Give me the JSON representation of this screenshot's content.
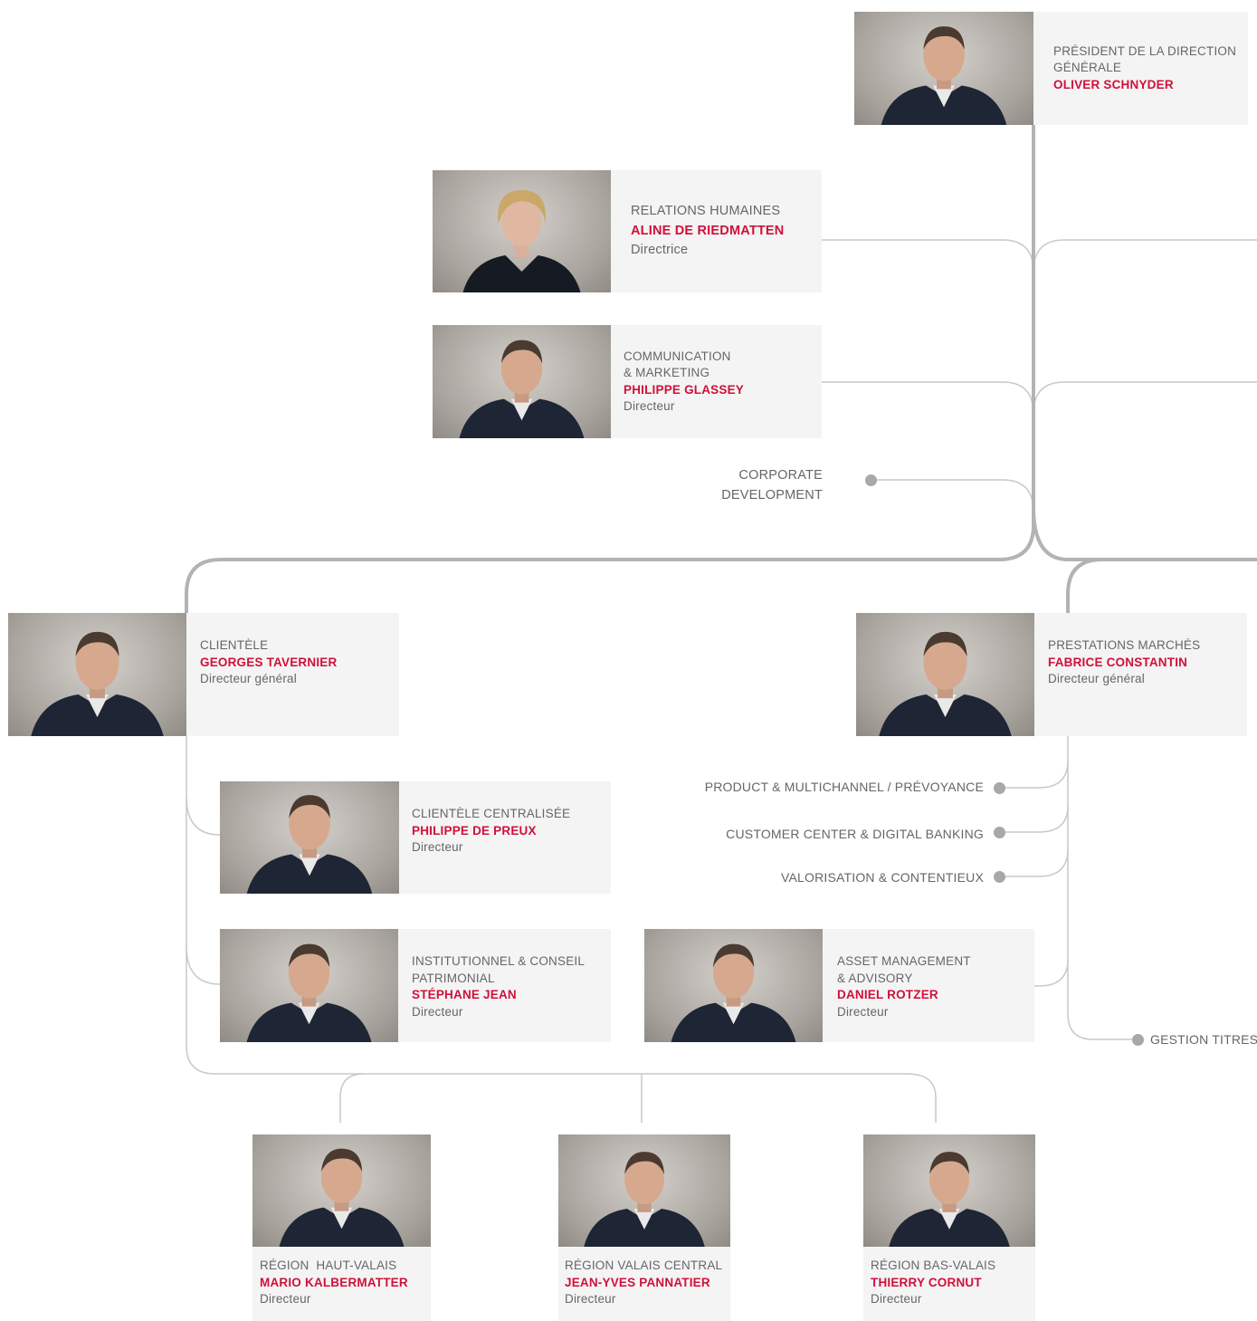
{
  "colors": {
    "accent": "#d0103a",
    "line": "#c8c8c8",
    "trunk": "#b5b5b5",
    "card": "#f4f4f4",
    "text": "#666666"
  },
  "president": {
    "role": "PRÉSIDENT DE LA DIRECTION GÉNÉRALE",
    "name": "OLIVER SCHNYDER"
  },
  "hr": {
    "role": "RELATIONS HUMAINES",
    "name": "ALINE DE RIEDMATTEN",
    "title": "Directrice"
  },
  "comm": {
    "role_line1": "COMMUNICATION",
    "role_line2": "& MARKETING",
    "name": "PHILIPPE GLASSEY",
    "title": "Directeur"
  },
  "corporate": {
    "line1": "CORPORATE",
    "line2": "DEVELOPMENT"
  },
  "clientele": {
    "role": "CLIENTÈLE",
    "name": "GEORGES TAVERNIER",
    "title": "Directeur général"
  },
  "prestations": {
    "role": "PRESTATIONS MARCHÉS",
    "name": "FABRICE CONSTANTIN",
    "title": "Directeur général"
  },
  "centralisee": {
    "role": "CLIENTÈLE CENTRALISÉE",
    "name": "PHILIPPE DE PREUX",
    "title": "Directeur"
  },
  "institutionnel": {
    "role_line1": "INSTITUTIONNEL & CONSEIL",
    "role_line2": "PATRIMONIAL",
    "name": "STÉPHANE JEAN",
    "title": "Directeur"
  },
  "asset": {
    "role_line1": "ASSET MANAGEMENT",
    "role_line2": "& ADVISORY",
    "name": "DANIEL ROTZER",
    "title": "Directeur"
  },
  "units": {
    "product": "PRODUCT & MULTICHANNEL / PRÉVOYANCE",
    "customer": "CUSTOMER CENTER & DIGITAL BANKING",
    "valorisation": "VALORISATION & CONTENTIEUX",
    "gestion": "GESTION TITRES"
  },
  "haut_valais": {
    "role": "RÉGION  HAUT-VALAIS",
    "name": "MARIO KALBERMATTER",
    "title": "Directeur"
  },
  "valais_central": {
    "role": "RÉGION VALAIS CENTRAL",
    "name": "JEAN-YVES PANNATIER",
    "title": "Directeur"
  },
  "bas_valais": {
    "role": "RÉGION BAS-VALAIS",
    "name": "THIERRY CORNUT",
    "title": "Directeur"
  }
}
